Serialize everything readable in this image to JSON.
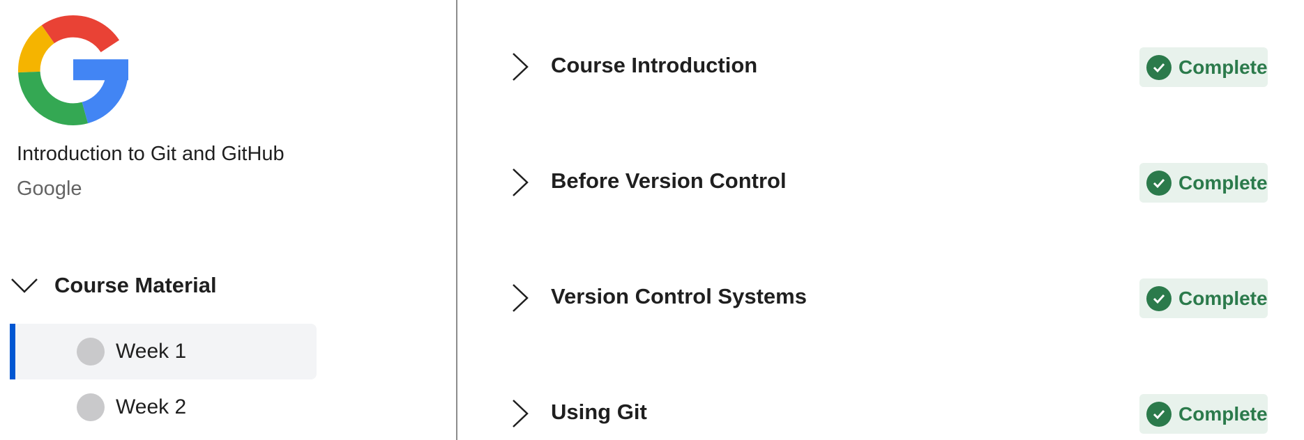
{
  "sidebar": {
    "logo_icon": "google-g-logo",
    "course_title": "Introduction to Git and GitHub",
    "course_org": "Google",
    "material": {
      "label": "Course Material",
      "icon": "chevron-down-icon",
      "weeks": [
        {
          "label": "Week 1",
          "active": true
        },
        {
          "label": "Week 2",
          "active": false
        }
      ]
    }
  },
  "main": {
    "lessons": [
      {
        "title": "Course Introduction",
        "status": "Complete"
      },
      {
        "title": "Before Version Control",
        "status": "Complete"
      },
      {
        "title": "Version Control Systems",
        "status": "Complete"
      },
      {
        "title": "Using Git",
        "status": "Complete"
      }
    ]
  },
  "colors": {
    "accent": "#0056d2",
    "complete_text": "#2b7a4b",
    "complete_bg": "#e8f2ec",
    "active_bg": "#f3f4f6",
    "dot": "#c9c9cb"
  }
}
